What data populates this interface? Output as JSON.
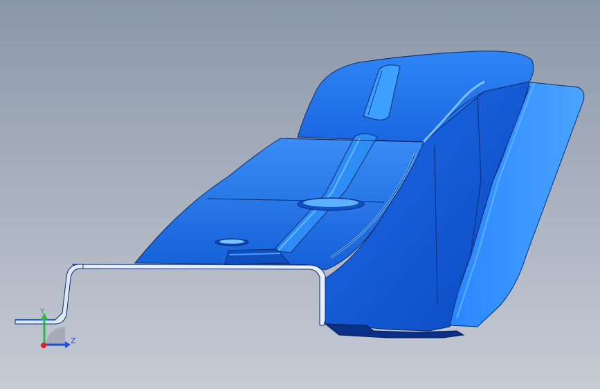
{
  "viewport": {
    "background_top": "#8a97a8",
    "background_bottom": "#c6cbd5"
  },
  "model": {
    "type": "sheet-metal-bracket",
    "color_primary": "#1f6fe6",
    "color_light": "#3d97ff",
    "color_dark": "#0b3fae",
    "edge_color": "#0a2a6e"
  },
  "triad": {
    "y_label": "Y",
    "z_label": "Z",
    "y_color": "#2fb34a",
    "z_color": "#1f4fd6",
    "x_color": "#e02020"
  }
}
